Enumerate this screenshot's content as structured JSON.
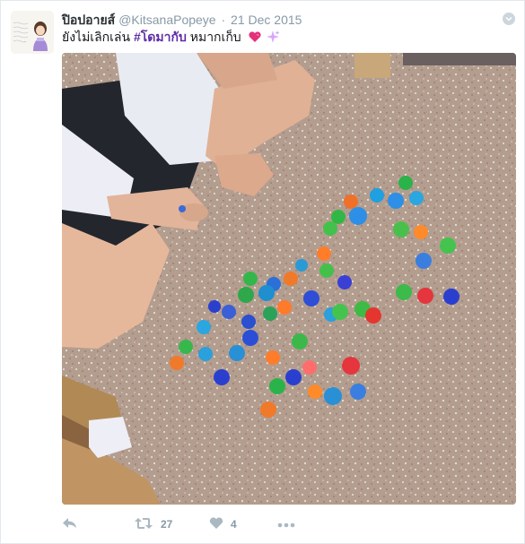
{
  "tweet": {
    "user": {
      "fullname": "ปิอปอายส์",
      "handle": "@KitsanaPopeye"
    },
    "separator": "·",
    "time": "21 Dec 2015",
    "text_plain": "ยังไม่เลิกเล่น",
    "hashtag": "#โดมากับ",
    "text_after": "หมากเก็บ",
    "emojis": [
      "heart-emoji",
      "sparkles-emoji"
    ],
    "media_alt": "Photo of colorful plastic toy pieces scattered on a terrazzo floor beside a seated student",
    "actions": {
      "reply_icon": "reply-icon",
      "retweet_icon": "retweet-icon",
      "retweet_count": "27",
      "like_icon": "heart-icon",
      "like_count": "4",
      "more_icon": "more-dots-icon"
    },
    "colors": {
      "hashtag": "#5e2ca5",
      "muted": "#8899a6",
      "action_icon": "#aab8c2"
    }
  }
}
